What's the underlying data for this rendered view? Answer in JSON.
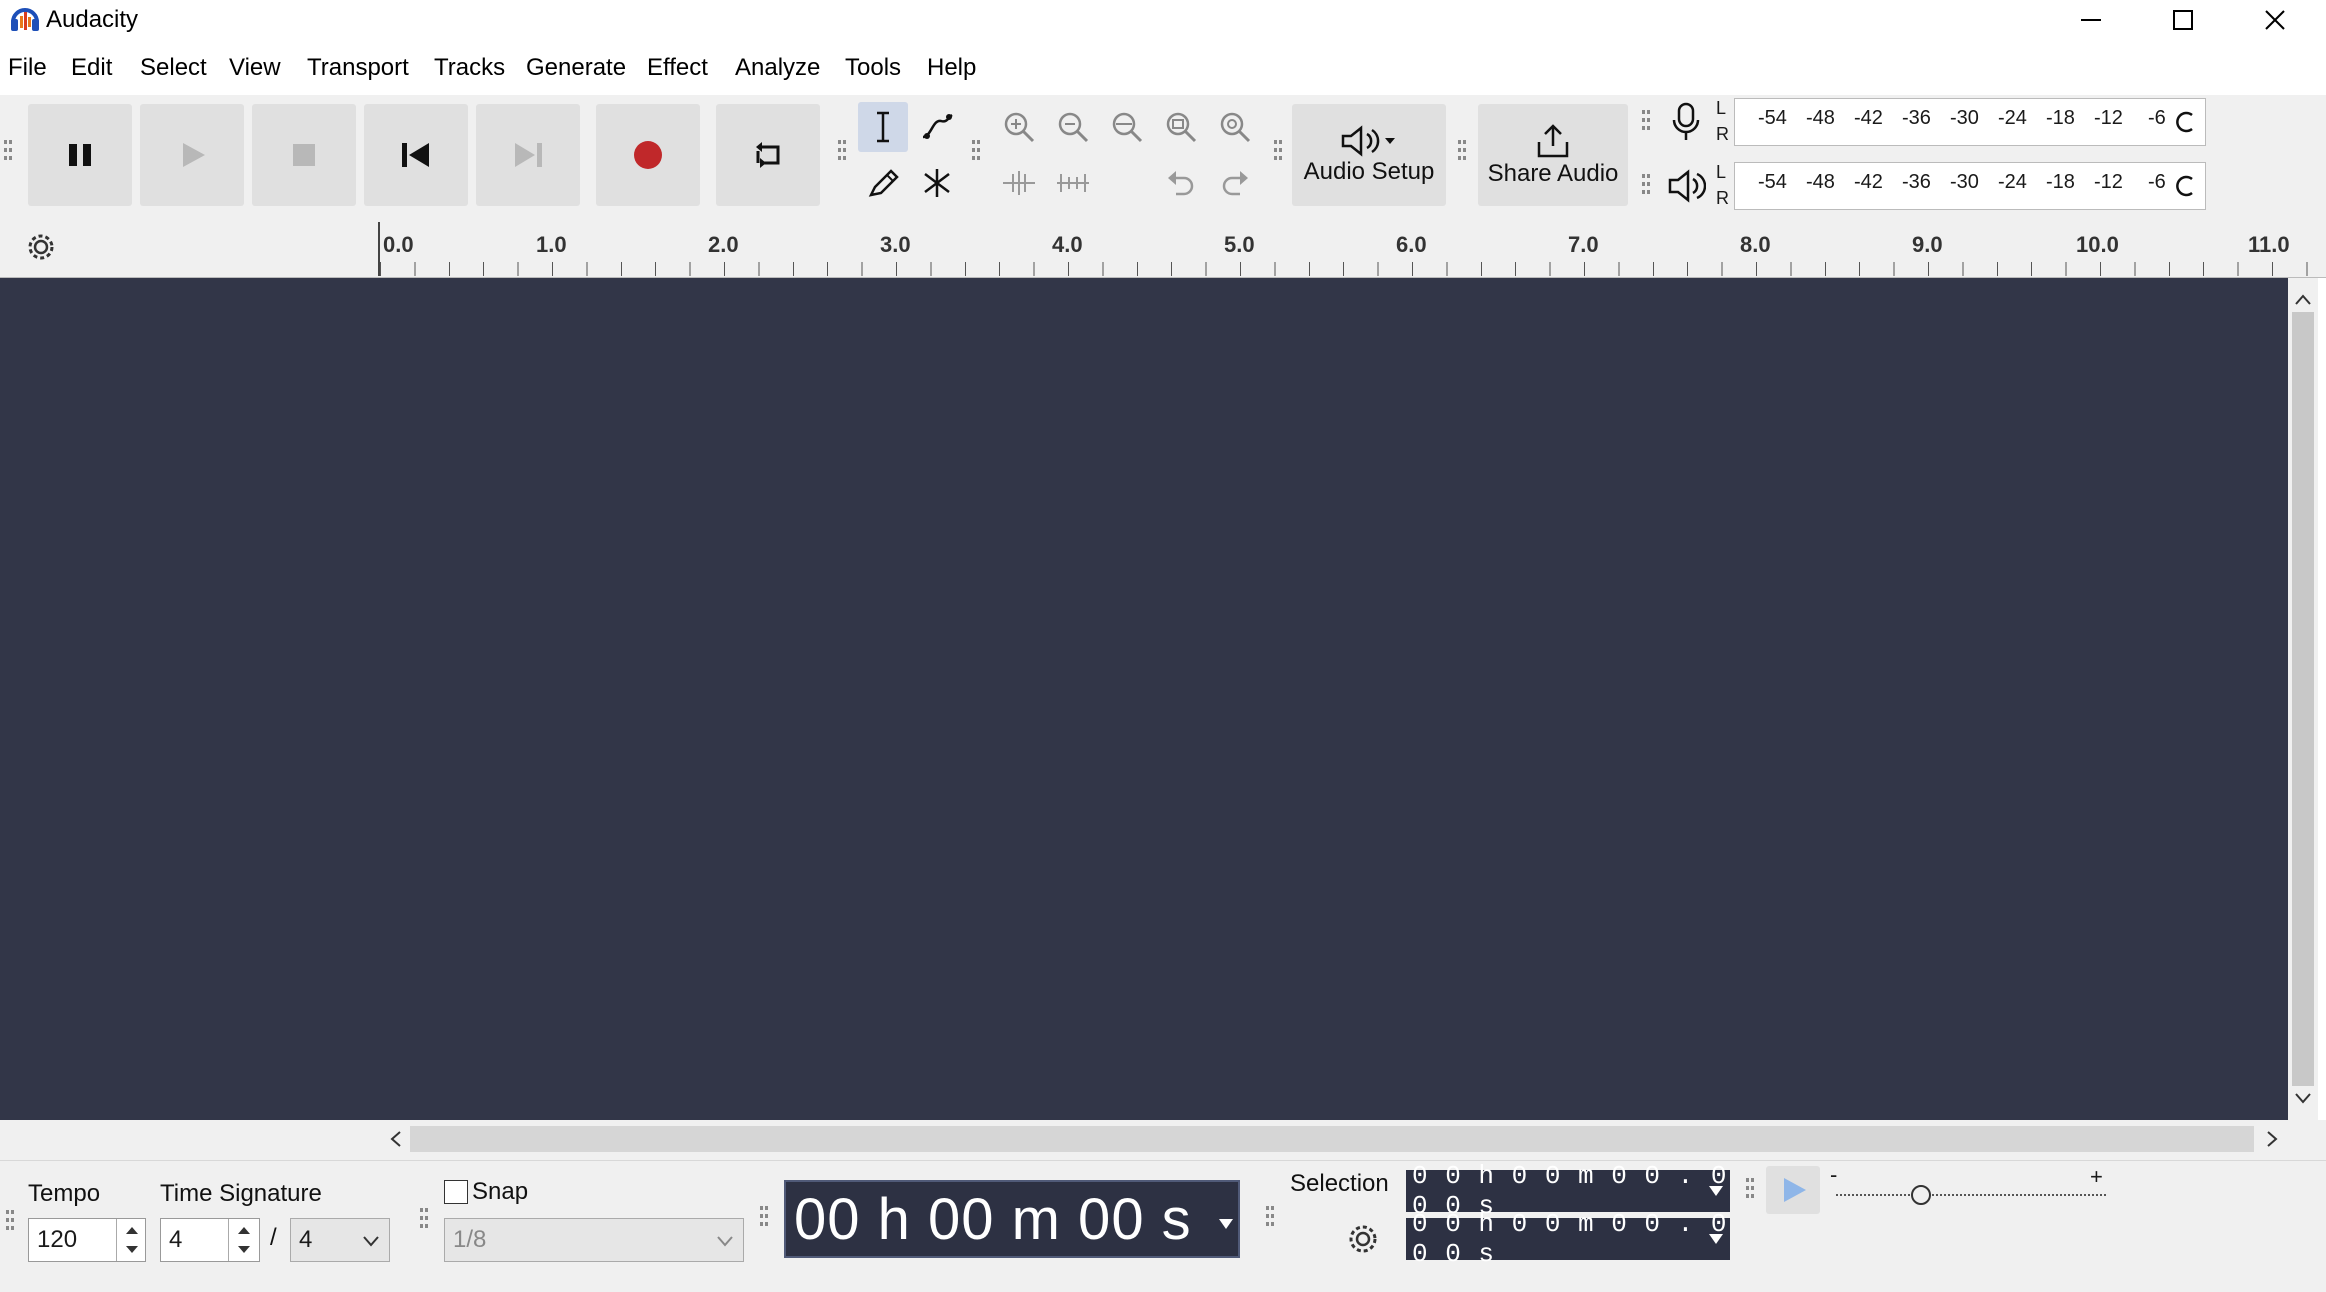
{
  "window": {
    "title": "Audacity"
  },
  "menu": [
    "File",
    "Edit",
    "Select",
    "View",
    "Transport",
    "Tracks",
    "Generate",
    "Effect",
    "Analyze",
    "Tools",
    "Help"
  ],
  "toolbar": {
    "audio_setup_label": "Audio Setup",
    "share_audio_label": "Share Audio",
    "meter_lr": [
      "L",
      "R"
    ],
    "meter_scale": [
      "-54",
      "-48",
      "-42",
      "-36",
      "-30",
      "-24",
      "-18",
      "-12",
      "-6"
    ]
  },
  "ruler": {
    "labels": [
      "0.0",
      "1.0",
      "2.0",
      "3.0",
      "4.0",
      "5.0",
      "6.0",
      "7.0",
      "8.0",
      "9.0",
      "10.0",
      "11.0"
    ]
  },
  "bottom": {
    "tempo_label": "Tempo",
    "tempo_value": "120",
    "timesig_label": "Time Signature",
    "timesig_num": "4",
    "timesig_sep": "/",
    "timesig_den": "4",
    "snap_label": "Snap",
    "snap_value": "1/8",
    "time_display": "00 h 00 m 00 s",
    "selection_label": "Selection",
    "selection_start": "0 0 h 0 0 m 0 0 . 0 0 0 s",
    "selection_end": "0 0 h 0 0 m 0 0 . 0 0 0 s",
    "speed_min": "-",
    "speed_max": "+"
  },
  "colors": {
    "track_bg": "#323648",
    "record": "#c0282a",
    "time_bg": "#2d3143"
  }
}
